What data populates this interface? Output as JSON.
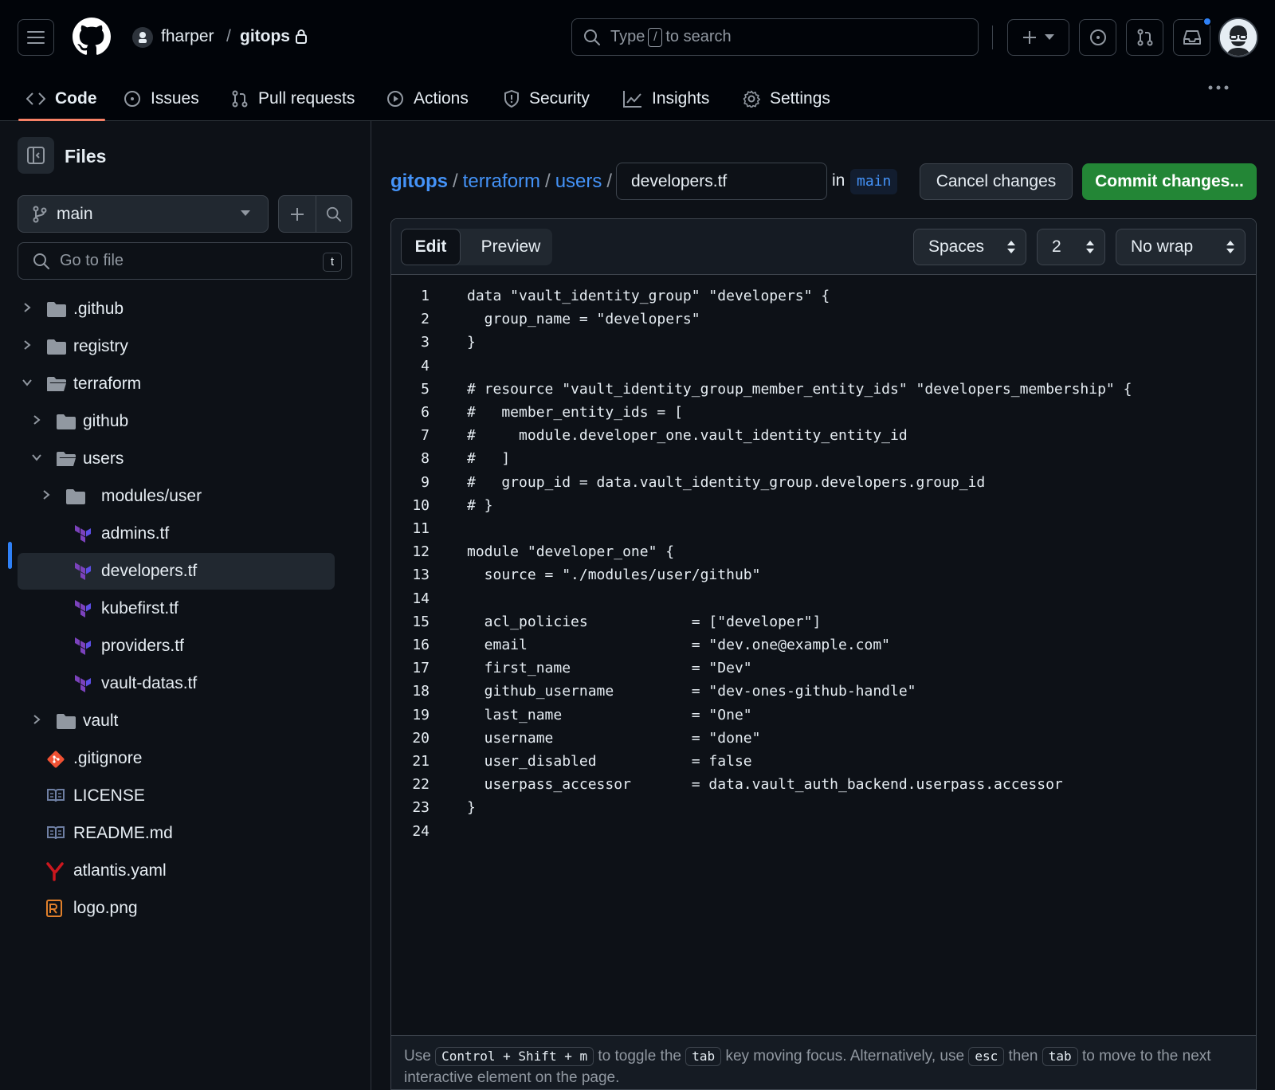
{
  "header": {
    "owner": "fharper",
    "separator": "/",
    "repo": "gitops",
    "search_placeholder_pre": "Type",
    "search_key": "/",
    "search_placeholder_post": "to search"
  },
  "repo_nav": {
    "tabs": [
      {
        "label": "Code",
        "icon": "code-icon",
        "active": true
      },
      {
        "label": "Issues",
        "icon": "issue-icon"
      },
      {
        "label": "Pull requests",
        "icon": "pull-request-icon"
      },
      {
        "label": "Actions",
        "icon": "play-icon"
      },
      {
        "label": "Security",
        "icon": "shield-icon"
      },
      {
        "label": "Insights",
        "icon": "graph-icon"
      },
      {
        "label": "Settings",
        "icon": "gear-icon"
      }
    ]
  },
  "sidebar": {
    "title": "Files",
    "branch": "main",
    "goto_placeholder": "Go to file",
    "goto_shortcut": "t",
    "tree": [
      {
        "label": ".github",
        "type": "folder",
        "expanded": false
      },
      {
        "label": "registry",
        "type": "folder",
        "expanded": false
      },
      {
        "label": "terraform",
        "type": "folder",
        "expanded": true
      },
      {
        "label": "github",
        "type": "folder",
        "expanded": false
      },
      {
        "label": "users",
        "type": "folder",
        "expanded": true
      },
      {
        "label": "modules/user",
        "type": "folder",
        "expanded": false
      },
      {
        "label": "admins.tf",
        "type": "terraform-file"
      },
      {
        "label": "developers.tf",
        "type": "terraform-file",
        "selected": true
      },
      {
        "label": "kubefirst.tf",
        "type": "terraform-file"
      },
      {
        "label": "providers.tf",
        "type": "terraform-file"
      },
      {
        "label": "vault-datas.tf",
        "type": "terraform-file"
      },
      {
        "label": "vault",
        "type": "folder",
        "expanded": false
      },
      {
        "label": ".gitignore",
        "type": "git-file"
      },
      {
        "label": "LICENSE",
        "type": "book-file"
      },
      {
        "label": "README.md",
        "type": "book-file"
      },
      {
        "label": "atlantis.yaml",
        "type": "yaml-file"
      },
      {
        "label": "logo.png",
        "type": "image-file"
      }
    ]
  },
  "editor": {
    "breadcrumb": [
      "gitops",
      "terraform",
      "users"
    ],
    "breadcrumb_sep": "/",
    "filename": "developers.tf",
    "in_label": "in",
    "branch": "main",
    "cancel_label": "Cancel changes",
    "commit_label": "Commit changes...",
    "edit_tab": "Edit",
    "preview_tab": "Preview",
    "indent_mode": "Spaces",
    "indent_size": "2",
    "wrap_mode": "No wrap",
    "lines": [
      "data \"vault_identity_group\" \"developers\" {",
      "  group_name = \"developers\"",
      "}",
      "",
      "# resource \"vault_identity_group_member_entity_ids\" \"developers_membership\" {",
      "#   member_entity_ids = [",
      "#     module.developer_one.vault_identity_entity_id",
      "#   ]",
      "#   group_id = data.vault_identity_group.developers.group_id",
      "# }",
      "",
      "module \"developer_one\" {",
      "  source = \"./modules/user/github\"",
      "",
      "  acl_policies            = [\"developer\"]",
      "  email                   = \"dev.one@example.com\"",
      "  first_name              = \"Dev\"",
      "  github_username         = \"dev-ones-github-handle\"",
      "  last_name               = \"One\"",
      "  username                = \"done\"",
      "  user_disabled           = false",
      "  userpass_accessor       = data.vault_auth_backend.userpass.accessor",
      "}",
      ""
    ],
    "footer": {
      "t1": "Use",
      "k1": "Control + Shift + m",
      "t2": "to toggle the",
      "k2": "tab",
      "t3": "key moving focus. Alternatively, use",
      "k3": "esc",
      "t4": "then",
      "k4": "tab",
      "t5": "to move to the next interactive element on the page."
    }
  },
  "colors": {
    "background": "#0d1117",
    "header_bg": "#010409",
    "accent_link": "#4493f8",
    "commit_green": "#238636",
    "active_tab_underline": "#f78166",
    "terraform_purple": "#7b42bc"
  }
}
